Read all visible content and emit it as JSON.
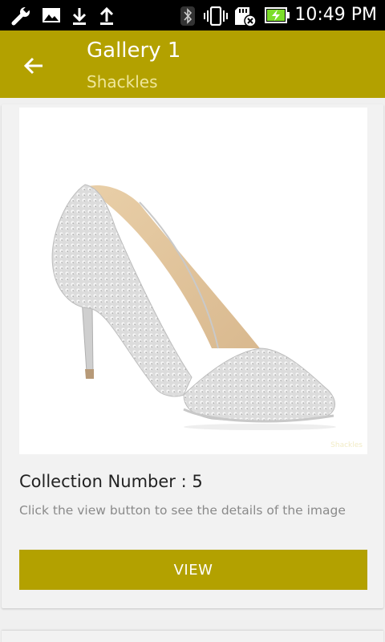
{
  "status_bar": {
    "time": "10:49 PM",
    "left_icons": [
      "wrench-icon",
      "image-icon",
      "download-icon",
      "upload-icon"
    ],
    "right_icons": [
      "bluetooth-icon",
      "vibrate-icon",
      "sd-card-error-icon",
      "battery-charging-icon"
    ]
  },
  "app_bar": {
    "title": "Gallery 1",
    "subtitle": "Shackles",
    "back_icon": "arrow-back-icon"
  },
  "card": {
    "image_alt": "Silver studded pointed-toe stiletto pump",
    "collection_label": "Collection Number : 5",
    "description": "Click the view button to see the details of the image",
    "view_button_label": "VIEW"
  },
  "colors": {
    "accent": "#b3a100",
    "subtitle": "#efe79a",
    "status_bar": "#000000",
    "background": "#f0f0f0",
    "card": "#f2f2f2",
    "battery": "#7cdd2a"
  }
}
